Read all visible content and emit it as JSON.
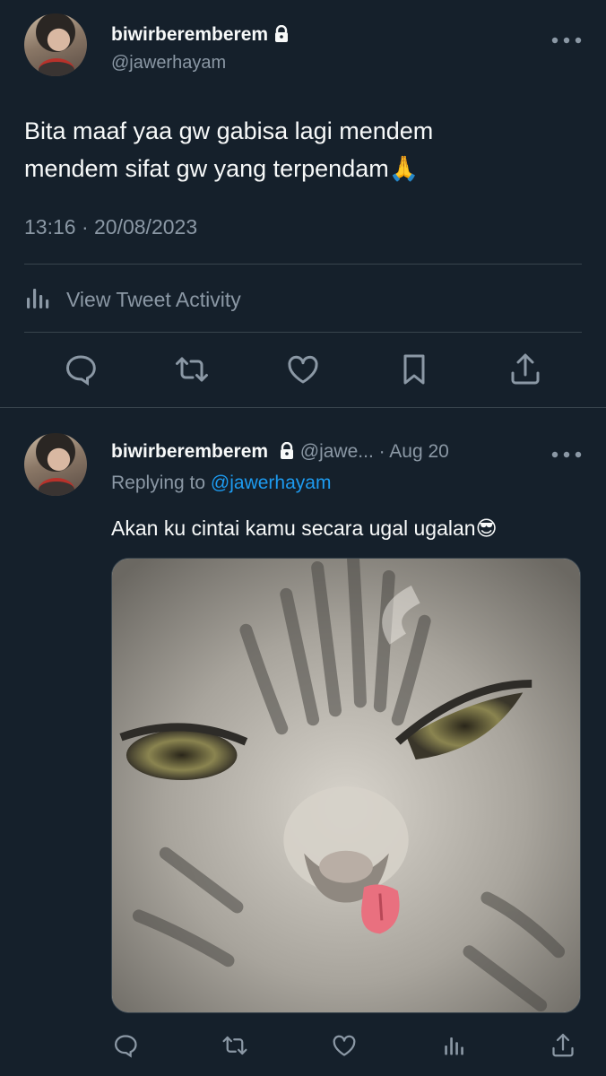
{
  "main_tweet": {
    "display_name": "biwirberemberem",
    "handle": "@jawerhayam",
    "text_line1": "Bita maaf yaa gw gabisa lagi mendem",
    "text_line2": "mendem sifat gw yang terpendam🙏",
    "timestamp": "13:16 · 20/08/2023",
    "activity_label": "View Tweet Activity",
    "actions": [
      "reply-icon",
      "retweet-icon",
      "like-icon",
      "bookmark-icon",
      "share-icon"
    ]
  },
  "reply": {
    "display_name": "biwirberemberem",
    "handle": "@jawe...",
    "date": "· Aug 20",
    "replying_prefix": "Replying to",
    "replying_handle": "@jawerhayam",
    "text": "Akan ku cintai kamu secara ugal ugalan😎",
    "media_alt": "cat sticking out tongue",
    "actions": [
      "reply-icon",
      "retweet-icon",
      "like-icon",
      "views-icon",
      "share-icon"
    ]
  },
  "colors": {
    "background": "#15202b",
    "text": "#f7f9f9",
    "muted": "#8b98a5",
    "link": "#1d9bf0",
    "divider": "#38444d"
  }
}
